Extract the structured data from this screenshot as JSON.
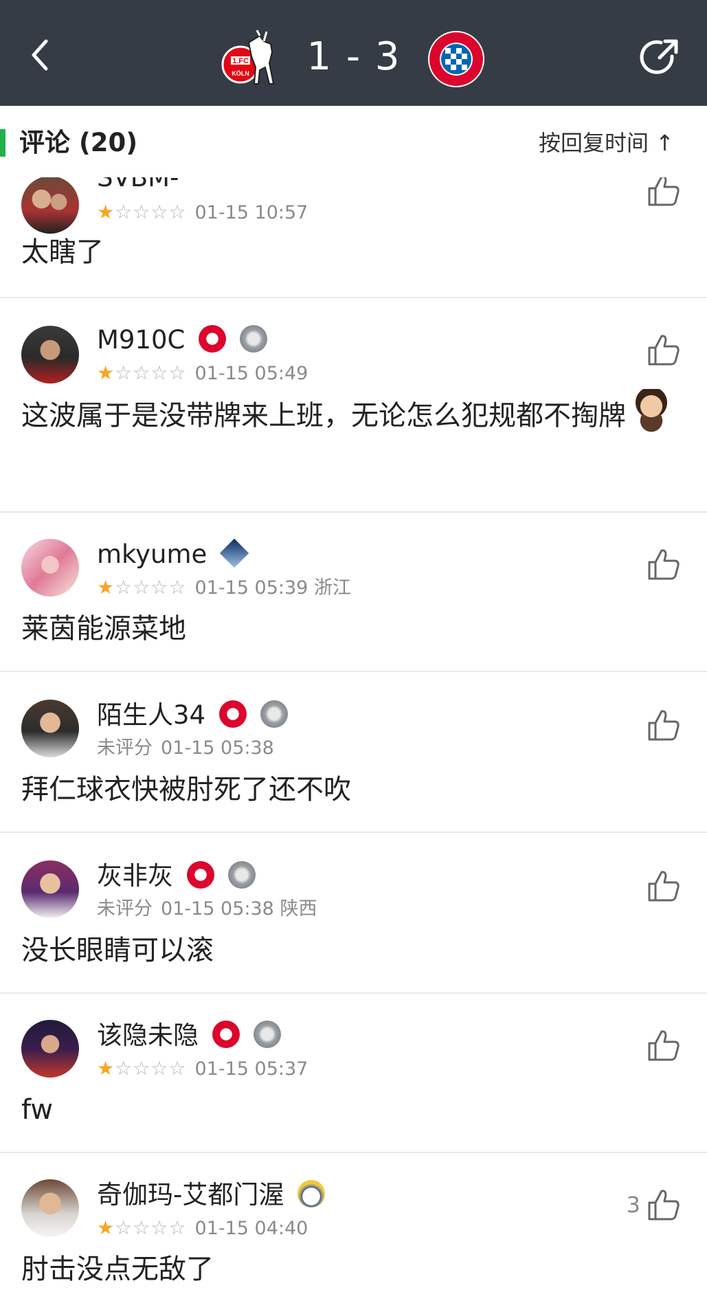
{
  "header": {
    "back_icon": "chevron-left-icon",
    "share_icon": "share-arrow-icon",
    "score": "1 - 3",
    "home_team_logo": "koln-logo",
    "away_team_logo": "bayern-logo"
  },
  "section": {
    "title": "评论 (20)",
    "sort_label": "按回复时间 ↑",
    "accent_color": "#22b14c"
  },
  "comments": [
    {
      "username": "SVBM-",
      "rating": 1,
      "rating_label": "",
      "time": "01-15 10:57",
      "location": "",
      "text": "太瞎了",
      "likes": ""
    },
    {
      "username": "M910C",
      "rating": 1,
      "rating_label": "",
      "time": "01-15 05:49",
      "location": "",
      "text": "这波属于是没带牌来上班，无论怎么犯规都不掏牌",
      "likes": ""
    },
    {
      "username": "mkyume",
      "rating": 1,
      "rating_label": "",
      "time": "01-15 05:39",
      "location": "浙江",
      "text": "莱茵能源菜地",
      "likes": ""
    },
    {
      "username": "陌生人34",
      "rating": 0,
      "rating_label": "未评分",
      "time": "01-15 05:38",
      "location": "",
      "text": "拜仁球衣快被肘死了还不吹",
      "likes": ""
    },
    {
      "username": "灰非灰",
      "rating": 0,
      "rating_label": "未评分",
      "time": "01-15 05:38",
      "location": "陕西",
      "text": "没长眼睛可以滚",
      "likes": ""
    },
    {
      "username": "该隐未隐",
      "rating": 1,
      "rating_label": "",
      "time": "01-15 05:37",
      "location": "",
      "text": "fw",
      "likes": ""
    },
    {
      "username": "奇伽玛-艾都门渥",
      "rating": 1,
      "rating_label": "",
      "time": "01-15 04:40",
      "location": "",
      "text": "肘击没点无敌了",
      "likes": "3"
    }
  ],
  "colors": {
    "topbar": "#353c45",
    "star": "#f5a623",
    "star_off": "#b5b5b5",
    "meta": "#8a8a8a"
  }
}
